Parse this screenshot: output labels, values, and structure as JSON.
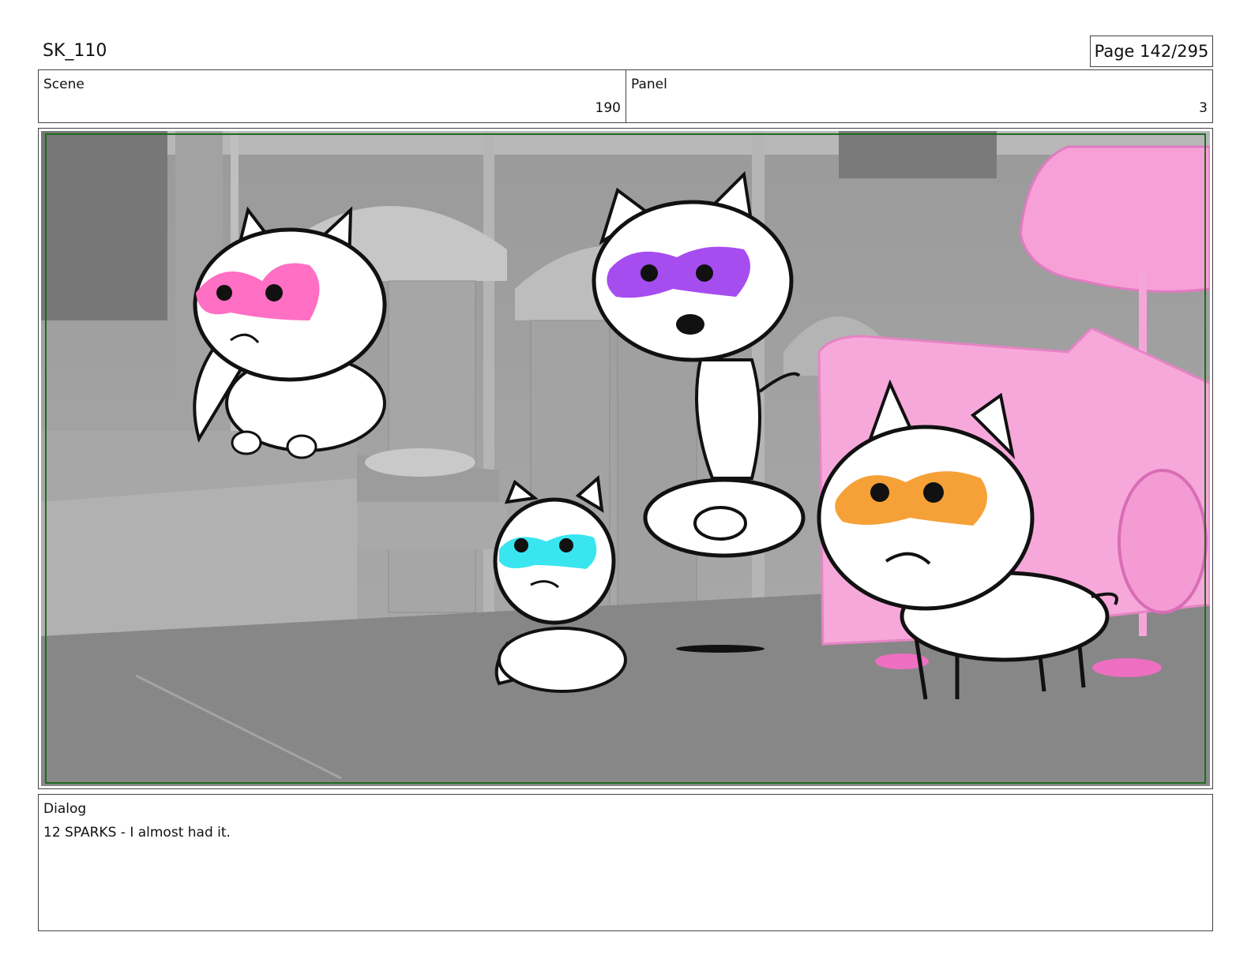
{
  "header": {
    "sequence": "SK_110",
    "page": "Page 142/295"
  },
  "scene": {
    "label": "Scene",
    "value": "190"
  },
  "panel": {
    "label": "Panel",
    "value": "3"
  },
  "artwork": {
    "mask_colors": {
      "left_kitten": "#ff6fc3",
      "center_kitten": "#a64df0",
      "small_kitten": "#39e6ef",
      "front_kitten": "#f5a138",
      "props": "#f7a0d8"
    }
  },
  "dialog": {
    "label": "Dialog",
    "text": "12 SPARKS - I almost had it."
  }
}
